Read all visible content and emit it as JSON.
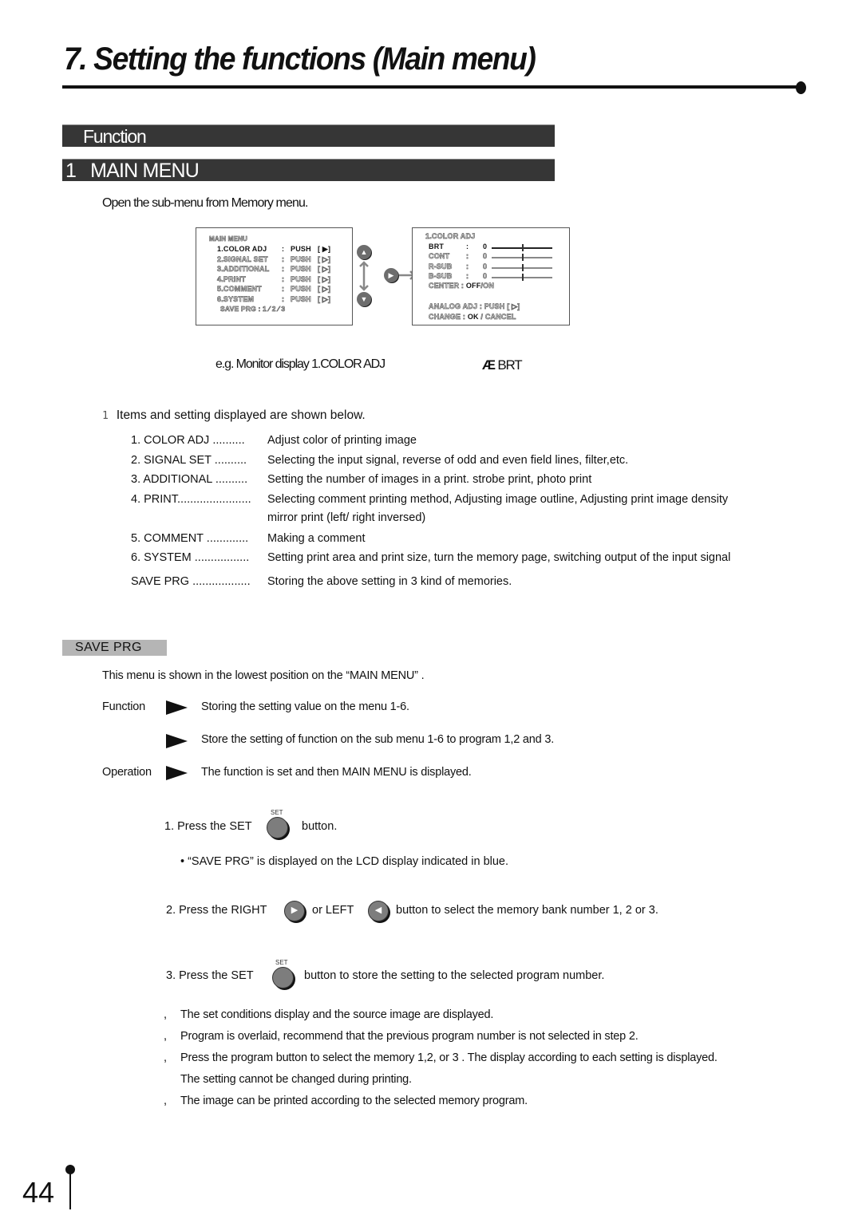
{
  "page": {
    "title": "7. Setting the functions (Main menu)",
    "page_number": "44"
  },
  "headers": {
    "function_bar": "Function",
    "main_menu_num": "1",
    "main_menu_label": "MAIN MENU"
  },
  "intro": "Open the sub-menu from Memory menu.",
  "main_screen": {
    "title": "MAIN MENU",
    "rows": [
      {
        "label": "1.COLOR ADJ",
        "sep": ":",
        "value": "PUSH",
        "bracket": "[ ▶]",
        "active": true
      },
      {
        "label": "2.SIGNAL  SET",
        "sep": ":",
        "value": "PUSH",
        "bracket": "[ ▷]",
        "active": false
      },
      {
        "label": "3.ADDITIONAL",
        "sep": ":",
        "value": "PUSH",
        "bracket": "[ ▷]",
        "active": false
      },
      {
        "label": "4.PRINT",
        "sep": ":",
        "value": "PUSH",
        "bracket": "[ ▷]",
        "active": false
      },
      {
        "label": "5.COMMENT",
        "sep": ":",
        "value": "PUSH",
        "bracket": "[ ▷]",
        "active": false
      },
      {
        "label": "6.SYSTEM",
        "sep": ":",
        "value": "PUSH",
        "bracket": "[ ▷]",
        "active": false
      }
    ],
    "save_prg": "SAVE PRG : 1 ⁄ 2 ⁄ 3"
  },
  "nav_buttons": {
    "up": "▲",
    "down": "▼",
    "right": "▶"
  },
  "sub_screen": {
    "title": "1.COLOR  ADJ",
    "sliders": [
      {
        "label": "BRT",
        "sep": ":",
        "value": "0",
        "active": true,
        "position": 0.5
      },
      {
        "label": "CONT",
        "sep": ":",
        "value": "0",
        "active": false,
        "position": 0.5
      },
      {
        "label": "R-SUB",
        "sep": ":",
        "value": "0",
        "active": false,
        "position": 0.5
      },
      {
        "label": "B-SUB",
        "sep": ":",
        "value": "0",
        "active": false,
        "position": 0.5
      }
    ],
    "center_label": "CENTER :",
    "center_off": "OFF",
    "center_on": "/ON",
    "analog_label": "ANALOG  ADJ  :  PUSH [ ▷]",
    "change_label": "CHANGE    :",
    "change_ok": "OK",
    "change_cancel": " / CANCEL"
  },
  "example": {
    "text": "e.g. Monitor display 1.COLOR ADJ",
    "arrow_glyph": "Æ",
    "target": "BRT"
  },
  "items": {
    "marker": "1",
    "heading": "Items and setting displayed are shown below.",
    "list": [
      {
        "label": "1. COLOR  ADJ ..........",
        "desc": "Adjust color of printing image"
      },
      {
        "label": "2. SIGNAL  SET ..........",
        "desc": "Selecting the input signal, reverse of odd and even field lines, filter,etc."
      },
      {
        "label": "3. ADDITIONAL  ..........",
        "desc": "Setting the number of images in a print. strobe print, photo print"
      },
      {
        "label": "4. PRINT.......................",
        "desc": "Selecting comment printing method, Adjusting image outline, Adjusting  print image density",
        "cont": "mirror print (left/ right inversed)"
      },
      {
        "label": "5. COMMENT  .............",
        "desc": "Making a comment"
      },
      {
        "label": "6. SYSTEM  .................",
        "desc": "Setting print area and print size, turn the memory page, switching output of the input signal"
      },
      {
        "label": "SAVE PRG ..................",
        "desc": "Storing the above setting in 3 kind of memories."
      }
    ]
  },
  "save_prg": {
    "tag": "SAVE  PRG",
    "intro": "This menu is shown in the lowest position on the “MAIN  MENU”  .",
    "function_label": "Function",
    "function_lines": [
      "Storing the setting value on the menu 1-6.",
      "Store the setting of function on the sub menu 1-6 to program 1,2 and 3."
    ],
    "operation_label": "Operation",
    "operation_line": "The function is set and then MAIN MENU is displayed."
  },
  "steps": {
    "set_caption": "SET",
    "step1_pre": "1. Press the SET",
    "step1_post": "button.",
    "step1_bullet": "•   “SAVE PRG” is displayed  on the LCD display indicated in blue.",
    "step2_pre": "2. Press the RIGHT",
    "step2_mid": "or  LEFT",
    "step2_post": "button to select the memory  bank number 1, 2 or 3.",
    "right_glyph": "▶",
    "left_glyph": "◀",
    "step3_pre": "3. Press the  SET",
    "step3_post": "button to store the setting  to the selected  program  number."
  },
  "notes": {
    "bullet": ",",
    "lines": [
      "The set conditions display and the source image are displayed.",
      "Program is overlaid, recommend that the previous program number is not selected in step 2.",
      "Press the program button to select the memory 1,2, or 3 . The display according to each setting is displayed.",
      "The image can be printed according to the selected memory program."
    ],
    "continuation": "The setting cannot be changed during printing."
  }
}
